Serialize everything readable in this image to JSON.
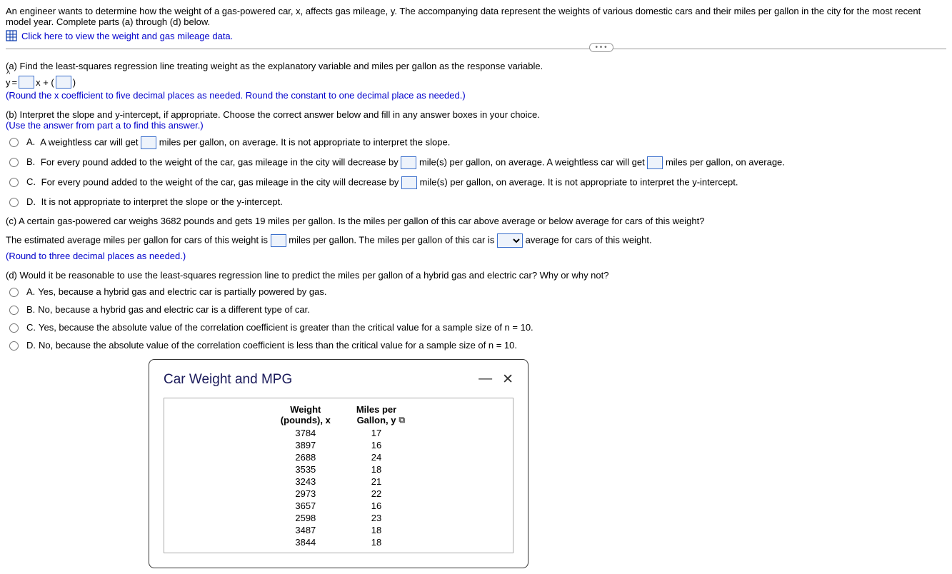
{
  "intro": "An engineer wants to determine how the weight of a gas-powered car, x, affects gas mileage, y. The accompanying data represent the weights of various domestic cars and their miles per gallon in the city for the most recent model year. Complete parts (a) through (d) below.",
  "data_link": "Click here to view the weight and gas mileage data.",
  "ellipsis": "• • •",
  "part_a": {
    "prompt": "(a) Find the least-squares regression line treating weight as the explanatory variable and miles per gallon as the response variable.",
    "eq_y": "y",
    "eq_equals": " = ",
    "eq_x": "x + (",
    "eq_close": ")",
    "note": "(Round the x coefficient to five decimal places as needed. Round the constant to one decimal place as needed.)"
  },
  "part_b": {
    "prompt": "(b) Interpret the slope and y-intercept, if appropriate. Choose the correct answer below and fill in any answer boxes in your choice.",
    "subnote": "(Use the answer from part a to find this answer.)",
    "A_pre": "A weightless car will get ",
    "A_post": " miles per gallon, on average. It is not appropriate to interpret the slope.",
    "B_pre": "For every pound added to the weight of the car, gas mileage in the city will decrease by ",
    "B_mid": " mile(s) per gallon, on average. A weightless car will get ",
    "B_post": " miles per gallon, on average.",
    "C_pre": "For every pound added to the weight of the car, gas mileage in the city will decrease by ",
    "C_post": " mile(s) per gallon, on average. It is not appropriate to interpret the y-intercept.",
    "D": "It is not appropriate to interpret the slope or the y-intercept."
  },
  "labels": {
    "A": "A.",
    "B": "B.",
    "C": "C.",
    "D": "D."
  },
  "part_c": {
    "prompt": "(c) A certain gas-powered car weighs 3682 pounds and gets 19 miles per gallon. Is the miles per gallon of this car above average or below average for cars of this weight?",
    "line_pre": "The estimated average miles per gallon for cars of this weight is ",
    "line_mid": " miles per gallon. The miles per gallon of this car is ",
    "line_post": " average for cars of this weight.",
    "note": "(Round to three decimal places as needed.)"
  },
  "part_d": {
    "prompt": "(d) Would it be reasonable to use the least-squares regression line to predict the miles per gallon of a hybrid gas and electric car? Why or why not?",
    "A": "Yes, because a hybrid gas and electric car is partially powered by gas.",
    "B": "No, because a hybrid gas and electric car is a different type of car.",
    "C": "Yes, because the absolute value of the correlation coefficient is greater than the critical value for a sample size of n = 10.",
    "D": "No, because the absolute value of the correlation coefficient is less than the critical value for a sample size of n = 10."
  },
  "popup": {
    "title": "Car Weight and MPG",
    "col1": "Weight (pounds), x",
    "col2": "Miles per Gallon, y"
  },
  "chart_data": {
    "type": "table",
    "columns": [
      "Weight (pounds), x",
      "Miles per Gallon, y"
    ],
    "rows": [
      [
        3784,
        17
      ],
      [
        3897,
        16
      ],
      [
        2688,
        24
      ],
      [
        3535,
        18
      ],
      [
        3243,
        21
      ],
      [
        2973,
        22
      ],
      [
        3657,
        16
      ],
      [
        2598,
        23
      ],
      [
        3487,
        18
      ],
      [
        3844,
        18
      ]
    ]
  }
}
